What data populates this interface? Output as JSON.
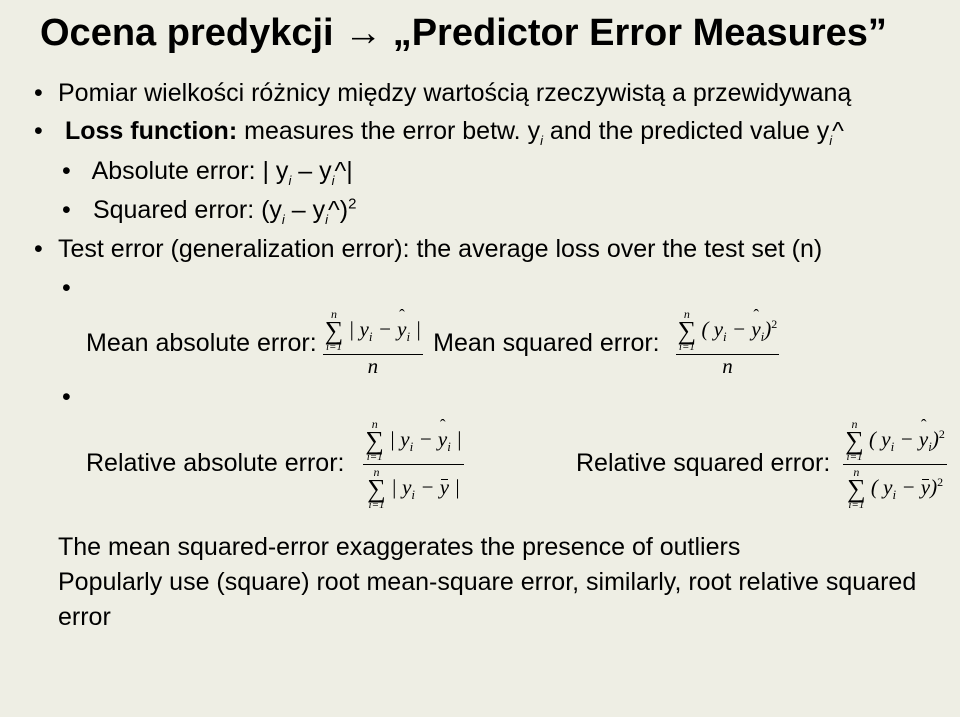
{
  "title_prefix": "Ocena predykcji ",
  "title_arrow": "→",
  "title_suffix": " „Predictor Error Measures”",
  "b1": "Pomiar wielkości różnicy między wartością rzeczywistą a przewidywaną",
  "b2_pre": "Loss function:",
  "b2_post": " measures the error betw. y",
  "b2_post2": " and the predicted value y",
  "b2_caret": "^",
  "b3": "Absolute error: | y",
  "b3b": " – y",
  "b3c": "^|",
  "b4": "Squared error:  (y",
  "b4b": " – y",
  "b4c": "^)",
  "b4sq": "2",
  "b5": "Test error (generalization error): the average loss over the test set (n)",
  "mae_label": "Mean absolute error:",
  "mse_label": "Mean squared error:",
  "rae_label": "Relative absolute error:",
  "rse_label": "Relative squared error:",
  "concl1": "The mean squared-error exaggerates the presence of outliers",
  "concl2": "Popularly use (square) root mean-square error, similarly, root relative squared error",
  "sym": {
    "n": "n",
    "i1": "i=1",
    "i": "i",
    "y": "y",
    "yhat": "y",
    "ybar": "y",
    "minus": " − ",
    "pipe": "|",
    "lp": "(",
    "rp": ")",
    "sq": "2"
  }
}
